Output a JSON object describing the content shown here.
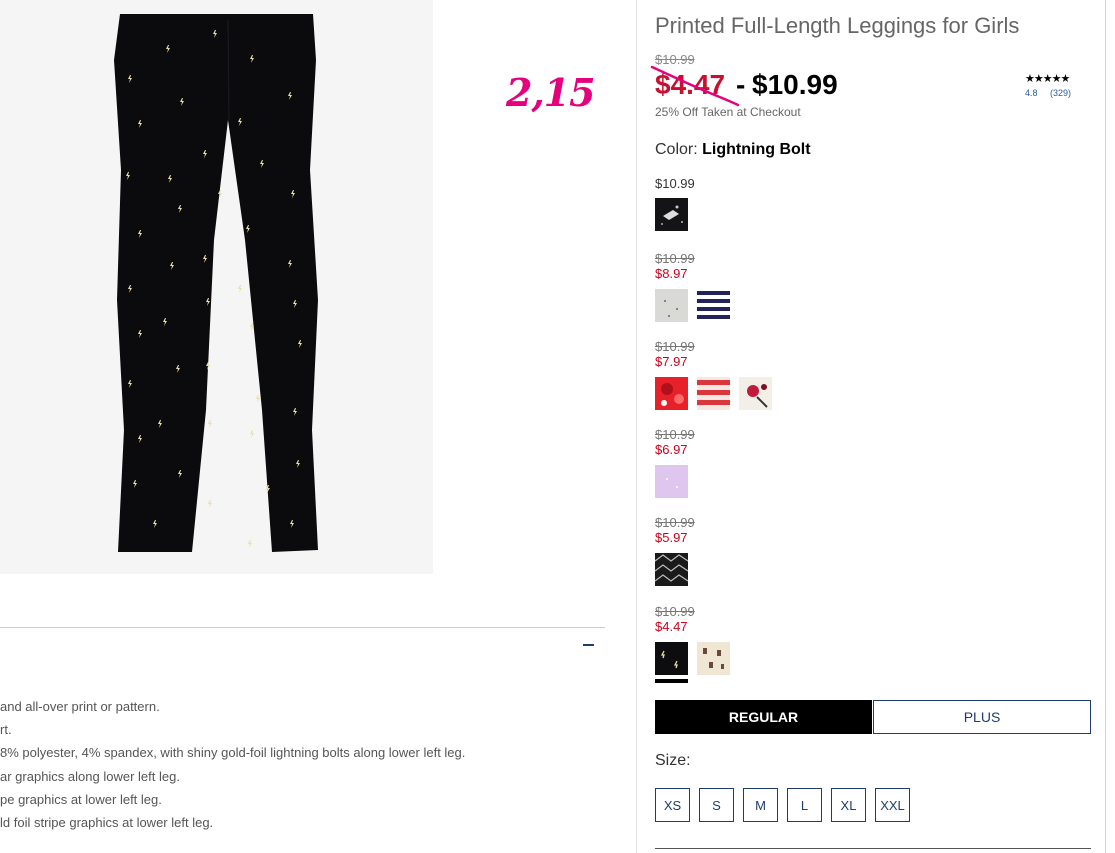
{
  "product": {
    "title": "Printed Full-Length Leggings for Girls",
    "original_price": "$10.99",
    "sale_price": "$4.47",
    "price_separator": "-",
    "regular_price": "$10.99",
    "discount_note": "25% Off Taken at Checkout",
    "rating": {
      "stars": "★★★★★",
      "score": "4.8",
      "count": "(329)"
    }
  },
  "annotation": "2,15",
  "color": {
    "label": "Color:",
    "value": "Lightning Bolt"
  },
  "price_groups": [
    {
      "regular": "$10.99",
      "original": "",
      "sale": "",
      "swatches": [
        "black-glitter",
        "white-splatter"
      ]
    },
    {
      "regular": "",
      "original": "$10.99",
      "sale": "$8.97",
      "swatches": [
        "heather-gray",
        "navy-stripe"
      ]
    },
    {
      "regular": "",
      "original": "$10.99",
      "sale": "$7.97",
      "swatches": [
        "red-floral",
        "red-stripe",
        "cream-floral"
      ]
    },
    {
      "regular": "",
      "original": "$10.99",
      "sale": "$6.97",
      "swatches": [
        "lavender"
      ]
    },
    {
      "regular": "",
      "original": "$10.99",
      "sale": "$5.97",
      "swatches": [
        "black-geometric"
      ]
    },
    {
      "regular": "",
      "original": "$10.99",
      "sale": "$4.47",
      "swatches": [
        "lightning-bolt",
        "cream-print"
      ]
    }
  ],
  "fit": {
    "options": [
      "REGULAR",
      "PLUS"
    ],
    "selected": "REGULAR"
  },
  "size": {
    "label": "Size:",
    "options": [
      "XS",
      "S",
      "M",
      "L",
      "XL",
      "XXL"
    ]
  },
  "details": [
    "and all-over print or pattern.",
    "rt.",
    "8% polyester, 4% spandex, with shiny gold-foil lightning bolts along lower left leg.",
    "ar graphics along lower left leg.",
    "pe graphics at lower left leg.",
    "ld foil stripe graphics at lower left leg."
  ],
  "colors": {
    "sale_red": "#c8102e",
    "navy": "#1f3c6e",
    "annotation_pink": "#e5007e"
  }
}
